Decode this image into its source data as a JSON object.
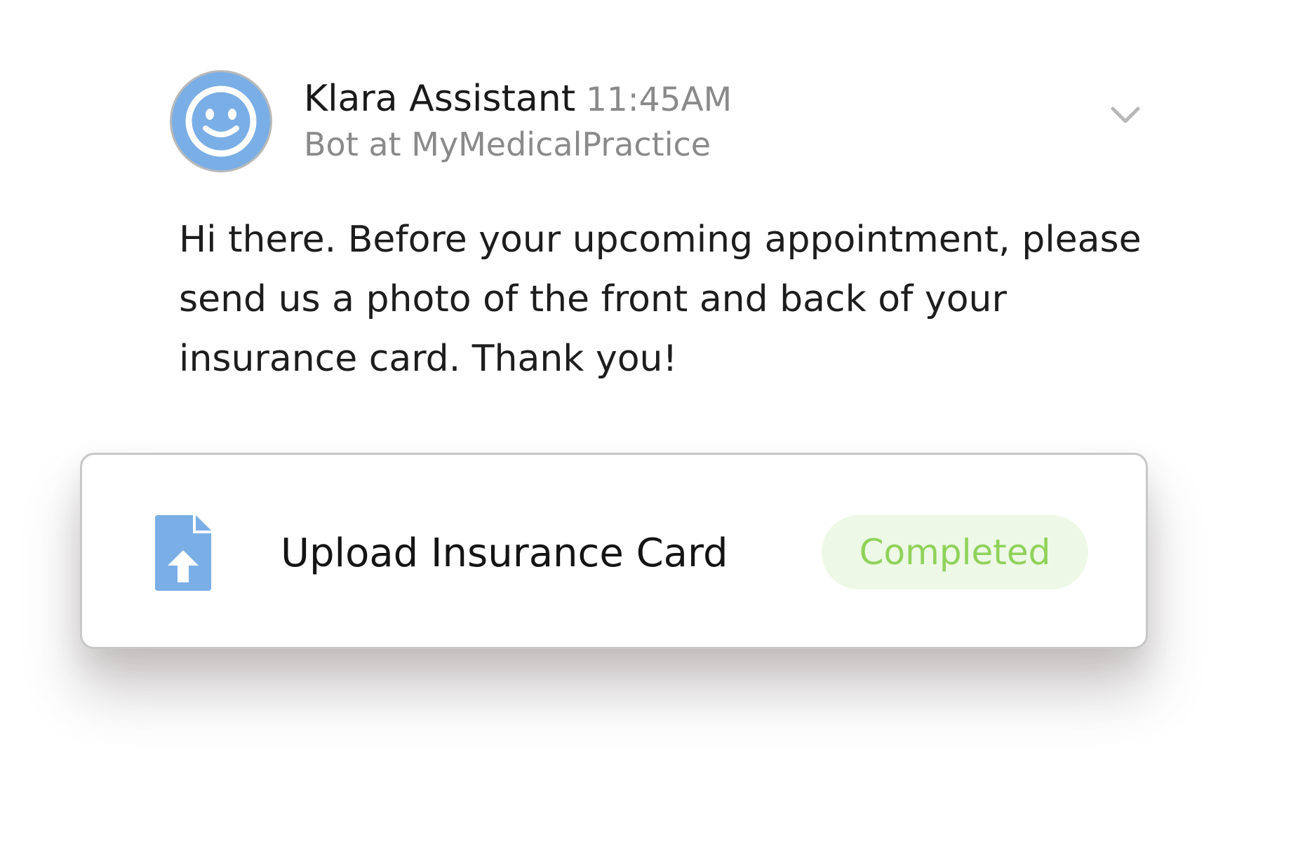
{
  "message": {
    "sender": {
      "name": "Klara Assistant",
      "timestamp": "11:45AM",
      "subtitle": "Bot at MyMedicalPractice",
      "avatar_icon": "smiley-face-icon",
      "avatar_color": "#7aaee6"
    },
    "menu_icon": "chevron-down-icon",
    "body_lines": [
      "Hi there. Before your upcoming appointment, please",
      "send us a photo of the front and back of your",
      "insurance card. Thank you!"
    ]
  },
  "task_card": {
    "icon": "file-upload-icon",
    "icon_color": "#7aaee6",
    "label": "Upload Insurance Card",
    "status": "Completed",
    "status_color": "#8fd25a",
    "status_background": "#eef8e6"
  }
}
